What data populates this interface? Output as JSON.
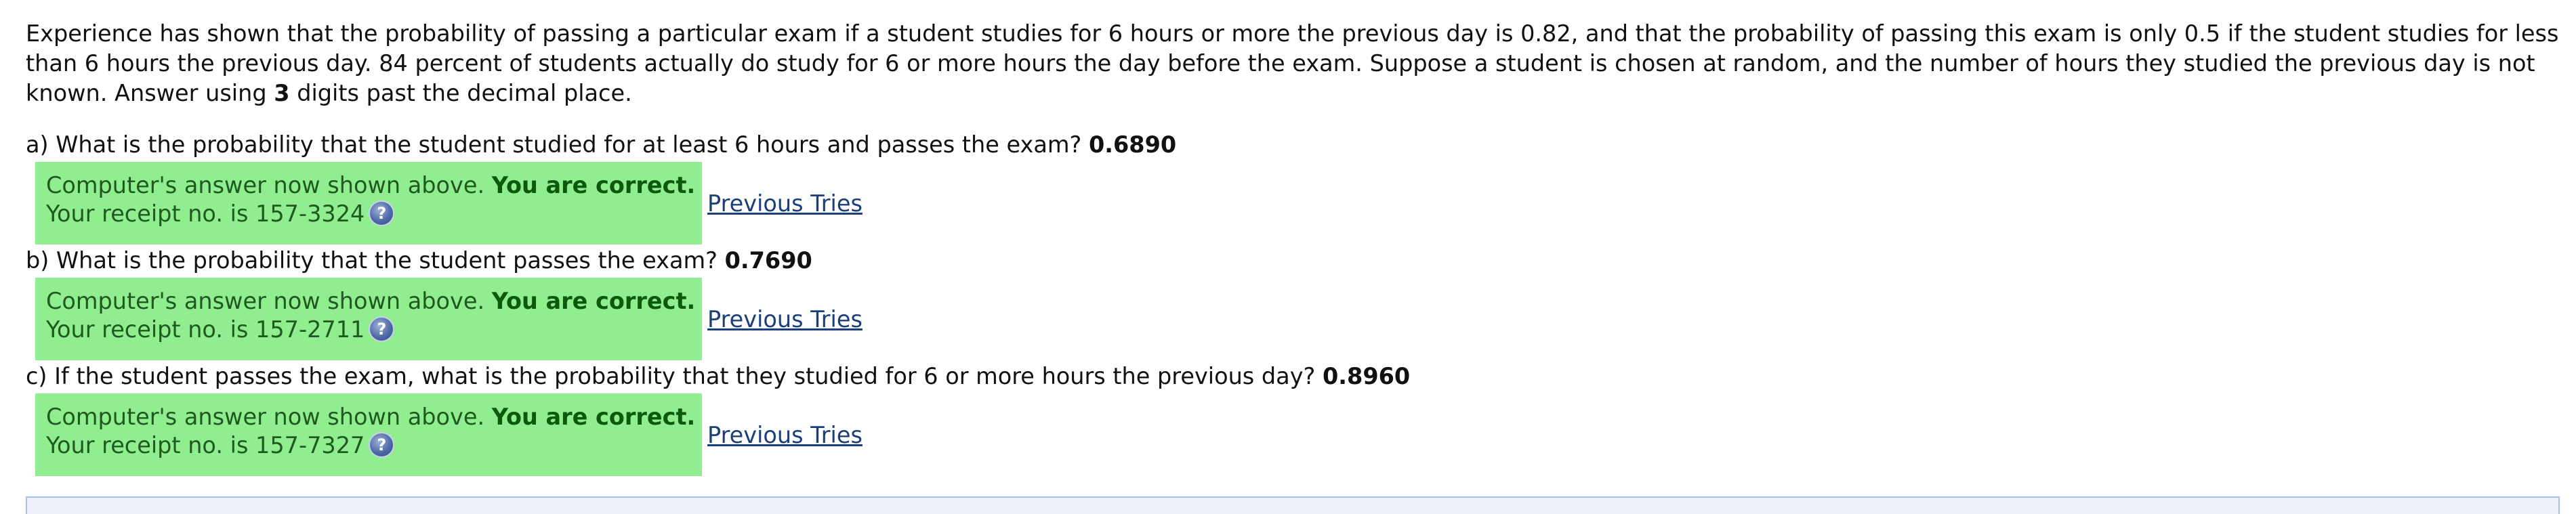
{
  "intro": {
    "before_bold": "Experience has shown that the probability of passing a particular exam if a student studies for 6 hours or more the previous day is 0.82, and that the probability of passing this exam is only 0.5 if the student studies for less than 6 hours the previous day. 84 percent of students actually do study for 6 or more hours the day before the exam. Suppose a student is chosen at random, and the number of hours they studied the previous day is not known. Answer using ",
    "bold": "3",
    "after_bold": " digits past the decimal place."
  },
  "questions": [
    {
      "text": "a) What is the probability that the student studied for at least 6 hours and passes the exam?",
      "answer": "0.6890",
      "feedback_prefix": "Computer's answer now shown above.",
      "feedback_bold": "You are correct.",
      "receipt": "Your receipt no. is 157-3324",
      "previous_tries": "Previous Tries"
    },
    {
      "text": "b) What is the probability that the student passes the exam?",
      "answer": "0.7690",
      "feedback_prefix": "Computer's answer now shown above.",
      "feedback_bold": "You are correct.",
      "receipt": "Your receipt no. is 157-2711",
      "previous_tries": "Previous Tries"
    },
    {
      "text": "c) If the student passes the exam, what is the probability that they studied for 6 or more hours the previous day?",
      "answer": "0.8960",
      "feedback_prefix": "Computer's answer now shown above.",
      "feedback_bold": "You are correct.",
      "receipt": "Your receipt no. is 157-7327",
      "previous_tries": "Previous Tries"
    }
  ],
  "colors": {
    "feedback_background": "#90ee90",
    "link": "#1a3f7a",
    "bottom_panel_background": "#eef0f9"
  },
  "icons": {
    "help": "question-mark-help-icon"
  }
}
